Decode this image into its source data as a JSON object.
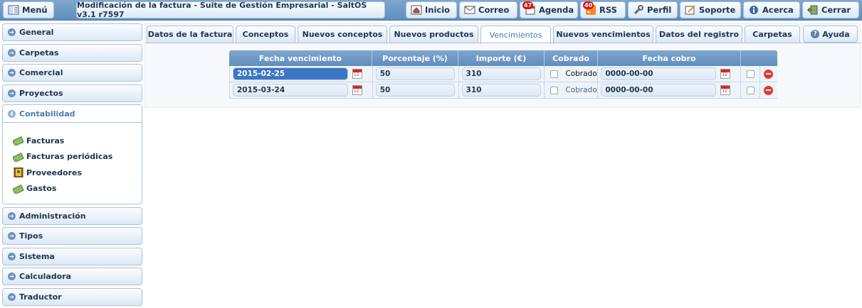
{
  "topbar": {
    "menu_label": "Menú",
    "title": "Modificación de la factura - Suite de Gestión Empresarial - SaltOS v3.1 r7597",
    "buttons": [
      {
        "label": "Inicio",
        "icon": "home-icon"
      },
      {
        "label": "Correo",
        "icon": "mail-icon"
      },
      {
        "label": "Agenda",
        "icon": "calendar-icon",
        "badge": "47"
      },
      {
        "label": "RSS",
        "icon": "rss-icon",
        "badge": "40"
      },
      {
        "label": "Perfil",
        "icon": "wrench-icon"
      },
      {
        "label": "Soporte",
        "icon": "edit-icon"
      },
      {
        "label": "Acerca",
        "icon": "info-icon"
      },
      {
        "label": "Cerrar",
        "icon": "exit-icon"
      }
    ]
  },
  "sidebar": {
    "items_top": [
      "General",
      "Carpetas",
      "Comercial",
      "Proyectos"
    ],
    "open_section": {
      "label": "Contabilidad",
      "items": [
        "Facturas",
        "Facturas periódicas",
        "Proveedores",
        "Gastos"
      ]
    },
    "items_bottom": [
      "Administración",
      "Tipos",
      "Sistema",
      "Calculadora",
      "Traductor"
    ]
  },
  "tabs": [
    "Datos de la factura",
    "Conceptos",
    "Nuevos conceptos",
    "Nuevos productos",
    "Vencimientos",
    "Nuevos vencimientos",
    "Datos del registro",
    "Carpetas"
  ],
  "active_tab": "Vencimientos",
  "help_label": "Ayuda",
  "table": {
    "headers": [
      "Fecha vencimiento",
      "Porcentaje (%)",
      "Importe (€)",
      "Cobrado",
      "Fecha cobro"
    ],
    "rows": [
      {
        "fecha": "2015-02-25",
        "porcentaje": "50",
        "importe": "310",
        "cobrado_label": "Cobrado",
        "fecha_cobro": "0000-00-00"
      },
      {
        "fecha": "2015-03-24",
        "porcentaje": "50",
        "importe": "310",
        "cobrado_label": "Cobrado",
        "fecha_cobro": "0000-00-00"
      }
    ]
  },
  "colors": {
    "header": "#6e97c5",
    "accent": "#4a7bb0",
    "delete": "#e43a2f"
  }
}
